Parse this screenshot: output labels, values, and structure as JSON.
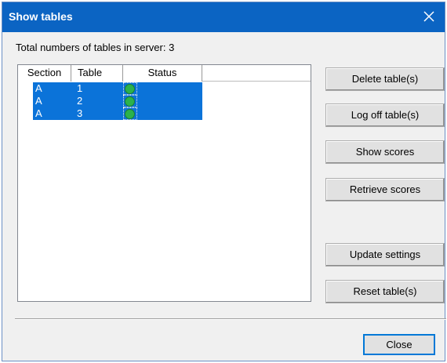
{
  "window": {
    "title": "Show tables"
  },
  "server_info": "Total numbers of tables in server: 3",
  "list": {
    "columns": [
      "Section",
      "Table",
      "Status"
    ],
    "rows": [
      {
        "section": "A",
        "table": "1",
        "status_icon": "green-circle-icon"
      },
      {
        "section": "A",
        "table": "2",
        "status_icon": "green-circle-icon"
      },
      {
        "section": "A",
        "table": "3",
        "status_icon": "green-circle-icon"
      }
    ]
  },
  "buttons": {
    "delete": "Delete table(s)",
    "logoff": "Log off table(s)",
    "show_scores": "Show scores",
    "retrieve_scores": "Retrieve scores",
    "update_settings": "Update settings",
    "reset": "Reset table(s)",
    "close": "Close"
  },
  "colors": {
    "titlebar": "#0b64c3",
    "selection": "#0b73d9",
    "status_ok": "#2bb24c"
  }
}
